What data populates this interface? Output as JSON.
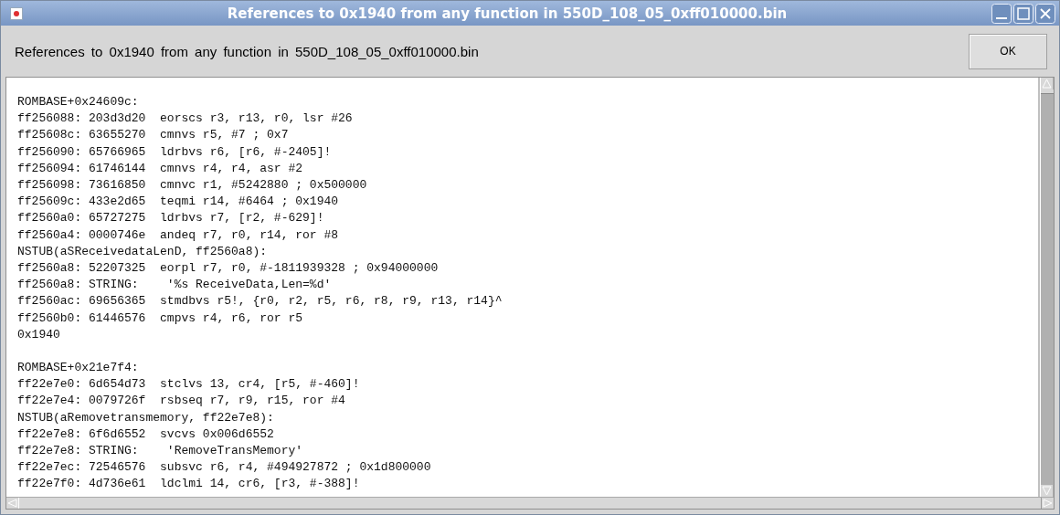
{
  "window": {
    "title": "References to 0x1940 from any function in 550D_108_05_0xff010000.bin"
  },
  "header": {
    "message": "References to 0x1940 from any function in 550D_108_05_0xff010000.bin",
    "button": "OK"
  },
  "listing": {
    "blocks": [
      {
        "lines": [
          "ROMBASE+0x24609c:",
          "ff256088: 203d3d20  eorscs r3, r13, r0, lsr #26",
          "ff25608c: 63655270  cmnvs r5, #7 ; 0x7",
          "ff256090: 65766965  ldrbvs r6, [r6, #-2405]!",
          "ff256094: 61746144  cmnvs r4, r4, asr #2",
          "ff256098: 73616850  cmnvc r1, #5242880 ; 0x500000",
          "ff25609c: 433e2d65  teqmi r14, #6464 ; 0x1940",
          "ff2560a0: 65727275  ldrbvs r7, [r2, #-629]!",
          "ff2560a4: 0000746e  andeq r7, r0, r14, ror #8",
          "NSTUB(aSReceivedataLenD, ff2560a8):",
          "ff2560a8: 52207325  eorpl r7, r0, #-1811939328 ; 0x94000000",
          "ff2560a8: STRING:    '%s ReceiveData,Len=%d'",
          "ff2560ac: 69656365  stmdbvs r5!, {r0, r2, r5, r6, r8, r9, r13, r14}^",
          "ff2560b0: 61446576  cmpvs r4, r6, ror r5",
          "0x1940"
        ]
      },
      {
        "lines": [
          "ROMBASE+0x21e7f4:",
          "ff22e7e0: 6d654d73  stclvs 13, cr4, [r5, #-460]!",
          "ff22e7e4: 0079726f  rsbseq r7, r9, r15, ror #4",
          "NSTUB(aRemovetransmemory, ff22e7e8):",
          "ff22e7e8: 6f6d6552  svcvs 0x006d6552",
          "ff22e7e8: STRING:    'RemoveTransMemory'",
          "ff22e7ec: 72546576  subsvc r6, r4, #494927872 ; 0x1d800000",
          "ff22e7f0: 4d736e61  ldclmi 14, cr6, [r3, #-388]!"
        ]
      }
    ]
  }
}
